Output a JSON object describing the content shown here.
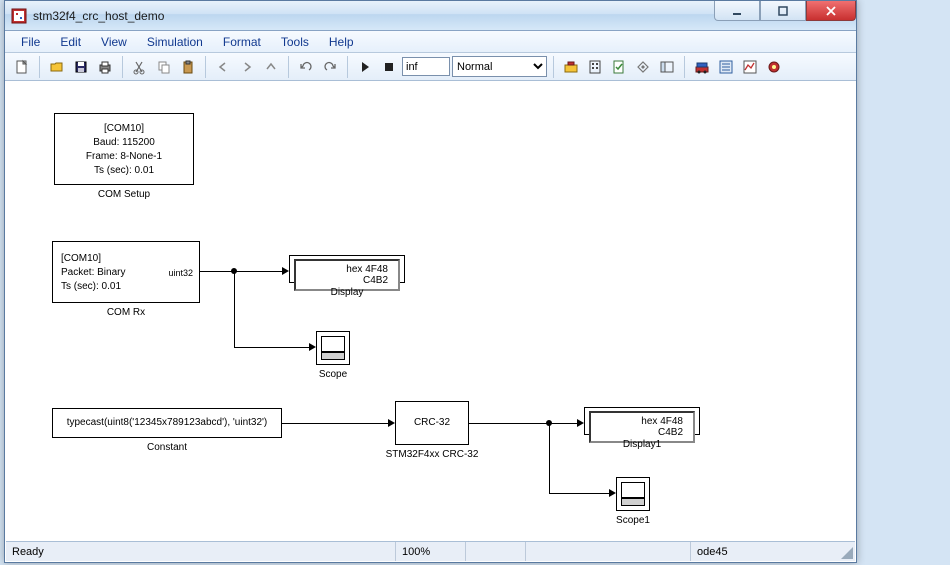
{
  "window": {
    "title": "stm32f4_crc_host_demo"
  },
  "menu": [
    "File",
    "Edit",
    "View",
    "Simulation",
    "Format",
    "Tools",
    "Help"
  ],
  "toolbar": {
    "stoptime": "inf",
    "mode_selected": "Normal"
  },
  "blocks": {
    "com_setup": {
      "lines": [
        "[COM10]",
        "Baud: 115200",
        "Frame: 8-None-1",
        "Ts (sec): 0.01"
      ],
      "label": "COM Setup"
    },
    "com_rx": {
      "lines": [
        "[COM10]",
        "Packet: Binary",
        "Ts (sec): 0.01"
      ],
      "label": "COM Rx",
      "port_type": "uint32"
    },
    "display": {
      "value": "hex 4F48 C4B2",
      "label": "Display"
    },
    "scope": {
      "label": "Scope"
    },
    "constant": {
      "text": "typecast(uint8('12345x789123abcd'), 'uint32')",
      "label": "Constant"
    },
    "crc": {
      "text": "CRC-32",
      "label": "STM32F4xx CRC-32"
    },
    "display1": {
      "value": "hex 4F48 C4B2",
      "label": "Display1"
    },
    "scope1": {
      "label": "Scope1"
    }
  },
  "status": {
    "ready": "Ready",
    "zoom": "100%",
    "solver": "ode45"
  }
}
